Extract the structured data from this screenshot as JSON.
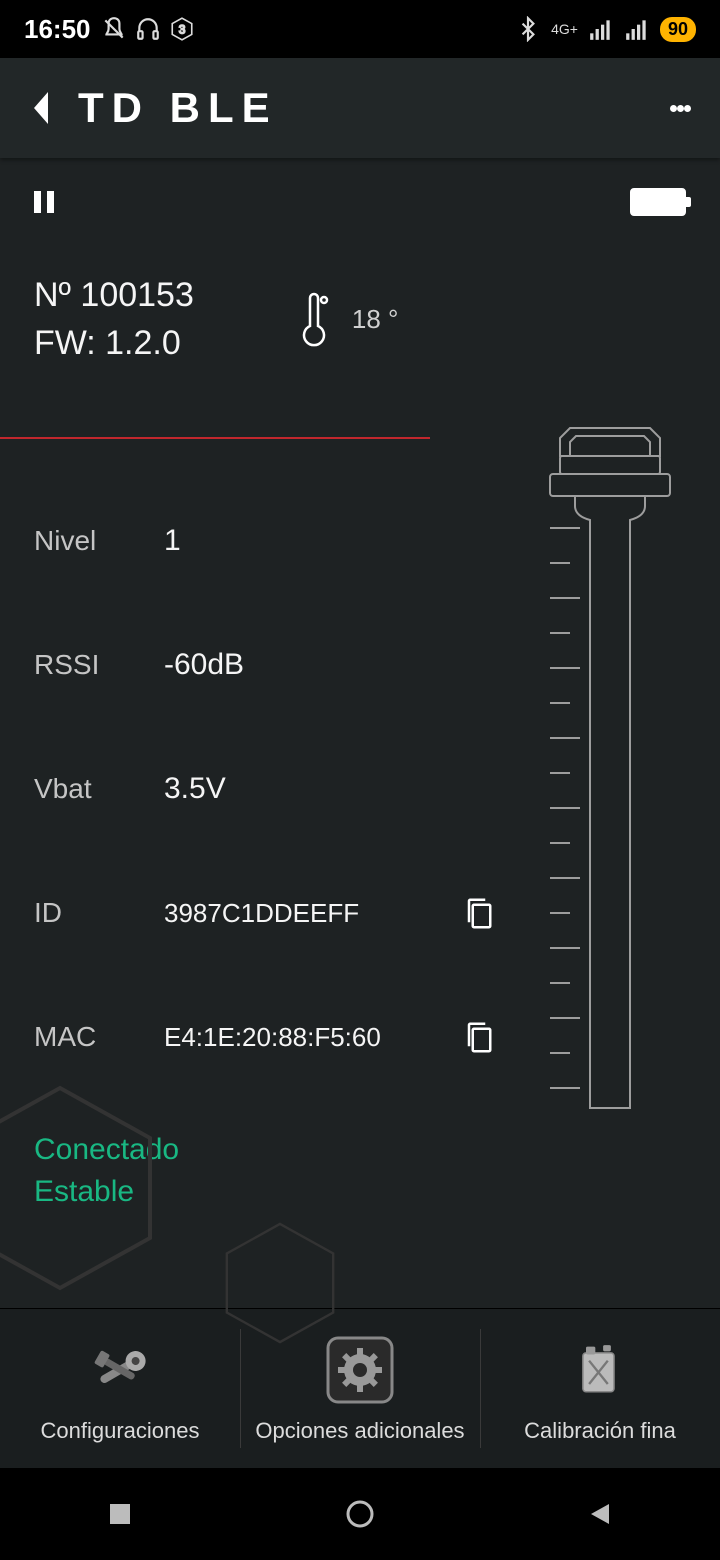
{
  "status": {
    "time": "16:50",
    "battery": "90",
    "network": "4G+"
  },
  "header": {
    "title": "TD BLE"
  },
  "device": {
    "serial_label": "Nº 100153",
    "fw_label": "FW: 1.2.0",
    "temperature": "18 °"
  },
  "stats": {
    "level": {
      "label": "Nivel",
      "value": "1"
    },
    "rssi": {
      "label": "RSSI",
      "value": "-60dB"
    },
    "vbat": {
      "label": "Vbat",
      "value": "3.5V"
    },
    "id": {
      "label": "ID",
      "value": "3987C1DDEEFF"
    },
    "mac": {
      "label": "MAC",
      "value": "E4:1E:20:88:F5:60"
    }
  },
  "connection": {
    "line1": "Conectado",
    "line2": "Estable"
  },
  "nav": {
    "config": "Configuraciones",
    "options": "Opciones adicionales",
    "calib": "Calibración fina"
  }
}
